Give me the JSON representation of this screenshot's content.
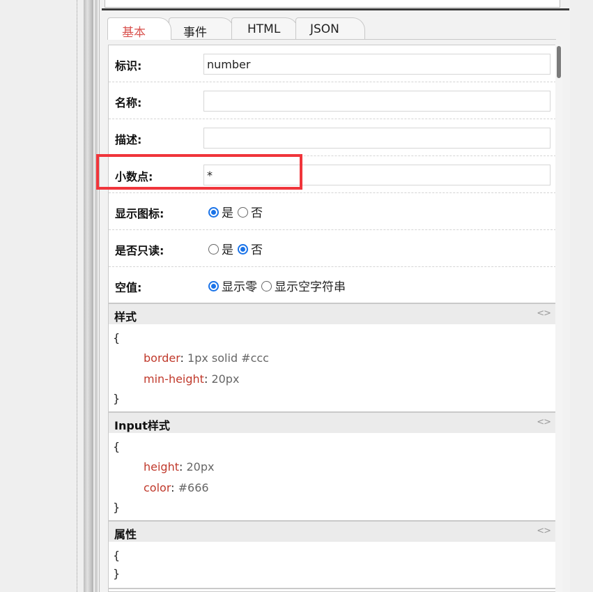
{
  "tabs": [
    "基本",
    "事件",
    "HTML",
    "JSON"
  ],
  "fields": {
    "id": {
      "label": "标识:",
      "value": "number"
    },
    "name": {
      "label": "名称:",
      "value": ""
    },
    "desc": {
      "label": "描述:",
      "value": ""
    },
    "decimal": {
      "label": "小数点:",
      "value": "*"
    }
  },
  "radios": {
    "show_icon": {
      "label": "显示图标:",
      "opt1": "是",
      "opt2": "否",
      "selected": "是"
    },
    "readonly": {
      "label": "是否只读:",
      "opt1": "是",
      "opt2": "否",
      "selected": "否"
    },
    "empty": {
      "label": "空值:",
      "opt1": "显示零",
      "opt2": "显示空字符串",
      "selected": "显示零"
    }
  },
  "style_section": {
    "title": "样式",
    "toggle": "<>",
    "open": "{",
    "close": "}",
    "props": [
      {
        "key": "border",
        "value": "1px solid #ccc"
      },
      {
        "key": "min-height",
        "value": "20px"
      }
    ]
  },
  "input_style_section": {
    "title": "Input样式",
    "toggle": "<>",
    "open": "{",
    "close": "}",
    "props": [
      {
        "key": "height",
        "value": "20px"
      },
      {
        "key": "color",
        "value": "#666"
      }
    ]
  },
  "attr_section": {
    "title": "属性",
    "toggle": "<>",
    "open": "{",
    "close": "}"
  },
  "colors": {
    "highlight": "#f0353b",
    "active_tab": "#d9534f",
    "radio": "#1a73e8",
    "code_key": "#c0392b"
  }
}
